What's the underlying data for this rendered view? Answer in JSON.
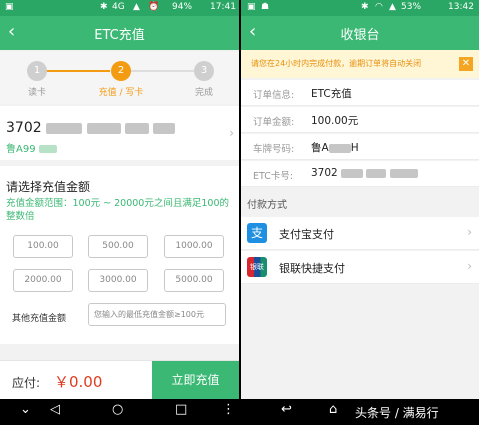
{
  "left": {
    "status": {
      "network": "4G",
      "battery": "94%",
      "time": "17:41"
    },
    "header": {
      "back": "‹",
      "title": "ETC充值"
    },
    "steps": [
      {
        "num": "1",
        "label": "读卡",
        "state": "done"
      },
      {
        "num": "2",
        "label": "充值 / 写卡",
        "state": "active"
      },
      {
        "num": "3",
        "label": "完成",
        "state": "pending"
      }
    ],
    "card": {
      "number_visible": "3702",
      "plate_visible": "鲁A99"
    },
    "amount": {
      "title": "请选择充值金额",
      "range_text": "充值金额范围：100元 ~ 20000元之间且满足100的整数倍",
      "options": [
        "100.00",
        "500.00",
        "1000.00",
        "2000.00",
        "3000.00",
        "5000.00"
      ],
      "other_label": "其他充值金额",
      "other_placeholder": "您输入的最低充值金额≥100元"
    },
    "bottom": {
      "pay_label": "应付:",
      "pay_amount": "￥0.00",
      "button": "立即充值"
    }
  },
  "right": {
    "status": {
      "battery": "53%",
      "time": "13:42"
    },
    "header": {
      "back": "‹",
      "title": "收银台"
    },
    "notice": "请您在24小时内完成付款，逾期订单将自动关闭",
    "order": [
      {
        "label": "订单信息:",
        "value": "ETC充值"
      },
      {
        "label": "订单金额:",
        "value": "100.00元"
      },
      {
        "label": "车牌号码:",
        "value": "鲁A"
      },
      {
        "label": "ETC卡号:",
        "value": "3702"
      }
    ],
    "plate_suffix": "H",
    "payment_title": "付款方式",
    "payment_methods": [
      {
        "label": "支付宝支付",
        "icon": "alipay-icon",
        "color": "#1e8fe1"
      },
      {
        "label": "银联快捷支付",
        "icon": "unionpay-icon",
        "color": "#d8262f"
      }
    ],
    "watermark": "头条号 / 满易行"
  },
  "colors": {
    "primary": "#3bb873",
    "status_bar": "#2aa764",
    "price": "#e03c1f",
    "notice_text": "#e8900f"
  }
}
